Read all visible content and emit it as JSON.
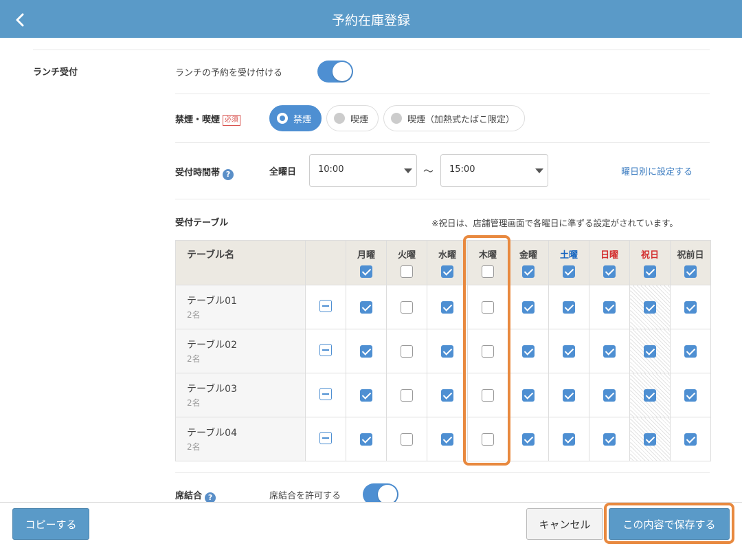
{
  "header": {
    "title": "予約在庫登録",
    "back_icon": "chevron-left-icon"
  },
  "lunch": {
    "label": "ランチ受付",
    "toggle_text": "ランチの予約を受け付ける",
    "enabled": true
  },
  "smoking": {
    "label": "禁煙・喫煙",
    "required_badge": "必須",
    "options": [
      "禁煙",
      "喫煙",
      "喫煙（加熱式たばこ限定）"
    ],
    "selected": "禁煙"
  },
  "reception_time": {
    "label": "受付時間帯",
    "help": "?",
    "all_days_label": "全曜日",
    "start": "10:00",
    "tilde": "〜",
    "end": "15:00",
    "per_day_link": "曜日別に設定する"
  },
  "tables": {
    "label": "受付テーブル",
    "note": "※祝日は、店舗管理画面で各曜日に準ずる設定がされています。",
    "name_header": "テーブル名",
    "days": [
      {
        "label": "月曜",
        "color": "#444444",
        "header_checked": true
      },
      {
        "label": "火曜",
        "color": "#444444",
        "header_checked": false
      },
      {
        "label": "水曜",
        "color": "#444444",
        "header_checked": true
      },
      {
        "label": "木曜",
        "color": "#444444",
        "header_checked": false
      },
      {
        "label": "金曜",
        "color": "#444444",
        "header_checked": true
      },
      {
        "label": "土曜",
        "color": "#1565c0",
        "header_checked": true
      },
      {
        "label": "日曜",
        "color": "#d32f2f",
        "header_checked": true
      },
      {
        "label": "祝日",
        "color": "#d32f2f",
        "header_checked": true
      },
      {
        "label": "祝前日",
        "color": "#444444",
        "header_checked": true
      }
    ],
    "rows": [
      {
        "name": "テーブル01",
        "capacity": "2名",
        "checks": [
          true,
          false,
          true,
          false,
          true,
          true,
          true,
          true,
          true
        ]
      },
      {
        "name": "テーブル02",
        "capacity": "2名",
        "checks": [
          true,
          false,
          true,
          false,
          true,
          true,
          true,
          true,
          true
        ]
      },
      {
        "name": "テーブル03",
        "capacity": "2名",
        "checks": [
          true,
          false,
          true,
          false,
          true,
          true,
          true,
          true,
          true
        ]
      },
      {
        "name": "テーブル04",
        "capacity": "2名",
        "checks": [
          true,
          false,
          true,
          false,
          true,
          true,
          true,
          true,
          true
        ]
      }
    ]
  },
  "seat_combine": {
    "label": "席結合",
    "help": "?",
    "toggle_text": "席結合を許可する",
    "enabled": true
  },
  "footer": {
    "copy_label": "コピーする",
    "cancel_label": "キャンセル",
    "save_label": "この内容で保存する"
  },
  "colors": {
    "accent": "#4e8fd2",
    "header": "#5a9ac8",
    "highlight": "#e8893f"
  }
}
